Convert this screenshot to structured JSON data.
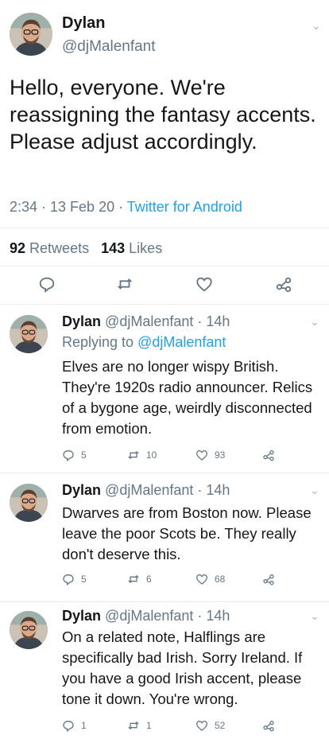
{
  "main_tweet": {
    "name": "Dylan",
    "handle": "@djMalenfant",
    "text": "Hello, everyone. We're reassigning the fantasy accents. Please adjust accordingly.",
    "time": "2:34 · 13 Feb 20 ·",
    "source": "Twitter for Android",
    "retweets_count": "92",
    "retweets_label": "Retweets",
    "likes_count": "143",
    "likes_label": "Likes"
  },
  "replies": [
    {
      "name": "Dylan",
      "handle_time": "@djMalenfant · 14h",
      "replying_label": "Replying to",
      "replying_to": "@djMalenfant",
      "text": "Elves are no longer wispy British. They're 1920s radio announcer. Relics of a bygone age, weirdly disconnected from emotion.",
      "replies": "5",
      "retweets": "10",
      "likes": "93"
    },
    {
      "name": "Dylan",
      "handle_time": "@djMalenfant · 14h",
      "text": "Dwarves are from Boston now. Please leave the poor Scots be. They really don't deserve this.",
      "replies": "5",
      "retweets": "6",
      "likes": "68"
    },
    {
      "name": "Dylan",
      "handle_time": "@djMalenfant · 14h",
      "text": "On a related note, Halflings are specifically bad Irish. Sorry Ireland. If you have a good Irish accent, please tone it down. You're wrong.",
      "replies": "1",
      "retweets": "1",
      "likes": "52"
    }
  ],
  "icons": {
    "chevron": "chevron-down-icon",
    "reply": "reply-icon",
    "retweet": "retweet-icon",
    "like": "heart-icon",
    "share": "share-icon"
  },
  "colors": {
    "link": "#1da1f2",
    "muted": "#657786",
    "text": "#14171a"
  }
}
